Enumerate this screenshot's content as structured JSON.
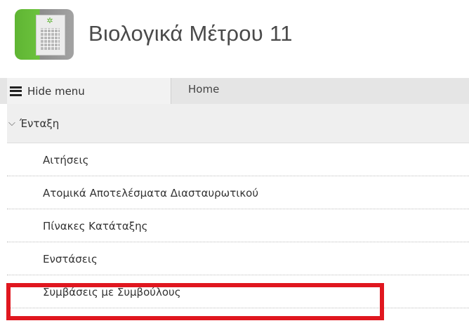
{
  "app": {
    "title": "Βιολογικά Μέτρου 11",
    "logo_icon": "document-grid-sprout-icon",
    "accent_color": "#5fb533"
  },
  "topbar": {
    "hide_menu_label": "Hide menu",
    "hide_menu_icon": "hamburger-icon",
    "home_tab_label": "Home"
  },
  "sidebar": {
    "section_label": "Ένταξη",
    "section_expanded": true,
    "items": [
      {
        "label": "Αιτήσεις"
      },
      {
        "label": "Ατομικά Αποτελέσματα Διασταυρωτικού"
      },
      {
        "label": "Πίνακες Κατάταξης"
      },
      {
        "label": "Ενστάσεις"
      },
      {
        "label": "Συμβάσεις με Συμβούλους",
        "highlighted": true
      }
    ]
  },
  "highlight_color": "#e0171f"
}
